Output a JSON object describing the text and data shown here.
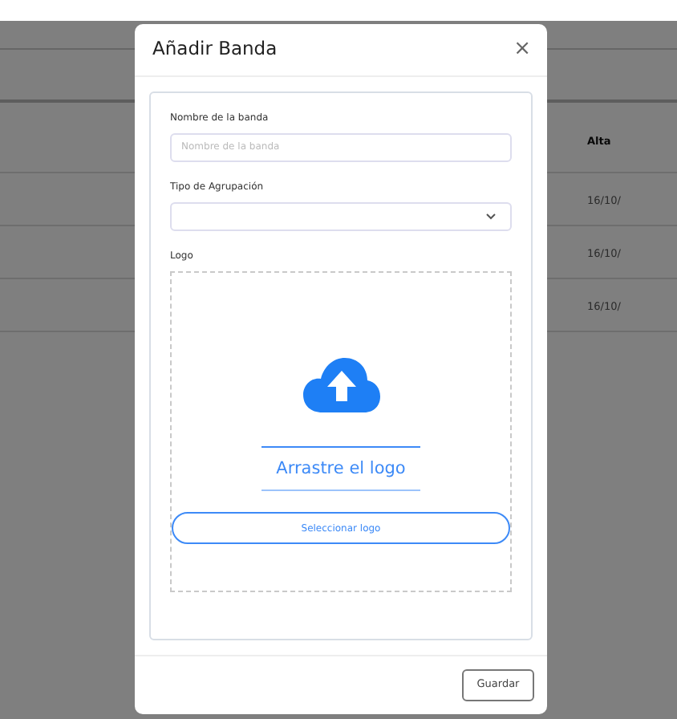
{
  "background_table": {
    "columns": [
      {
        "label": "Alta"
      }
    ],
    "rows": [
      {
        "alta": "16/10/"
      },
      {
        "alta": "16/10/"
      },
      {
        "alta": "16/10/"
      }
    ]
  },
  "modal": {
    "title": "Añadir Banda",
    "close": "×",
    "name_field": {
      "label": "Nombre de la banda",
      "placeholder": "Nombre de la banda"
    },
    "type_field": {
      "label": "Tipo de Agrupación"
    },
    "logo_field": {
      "label": "Logo",
      "drop_text": "Arrastre el logo",
      "select_button": "Seleccionar logo"
    },
    "buttons": [
      {
        "label": "Guardar"
      }
    ]
  }
}
